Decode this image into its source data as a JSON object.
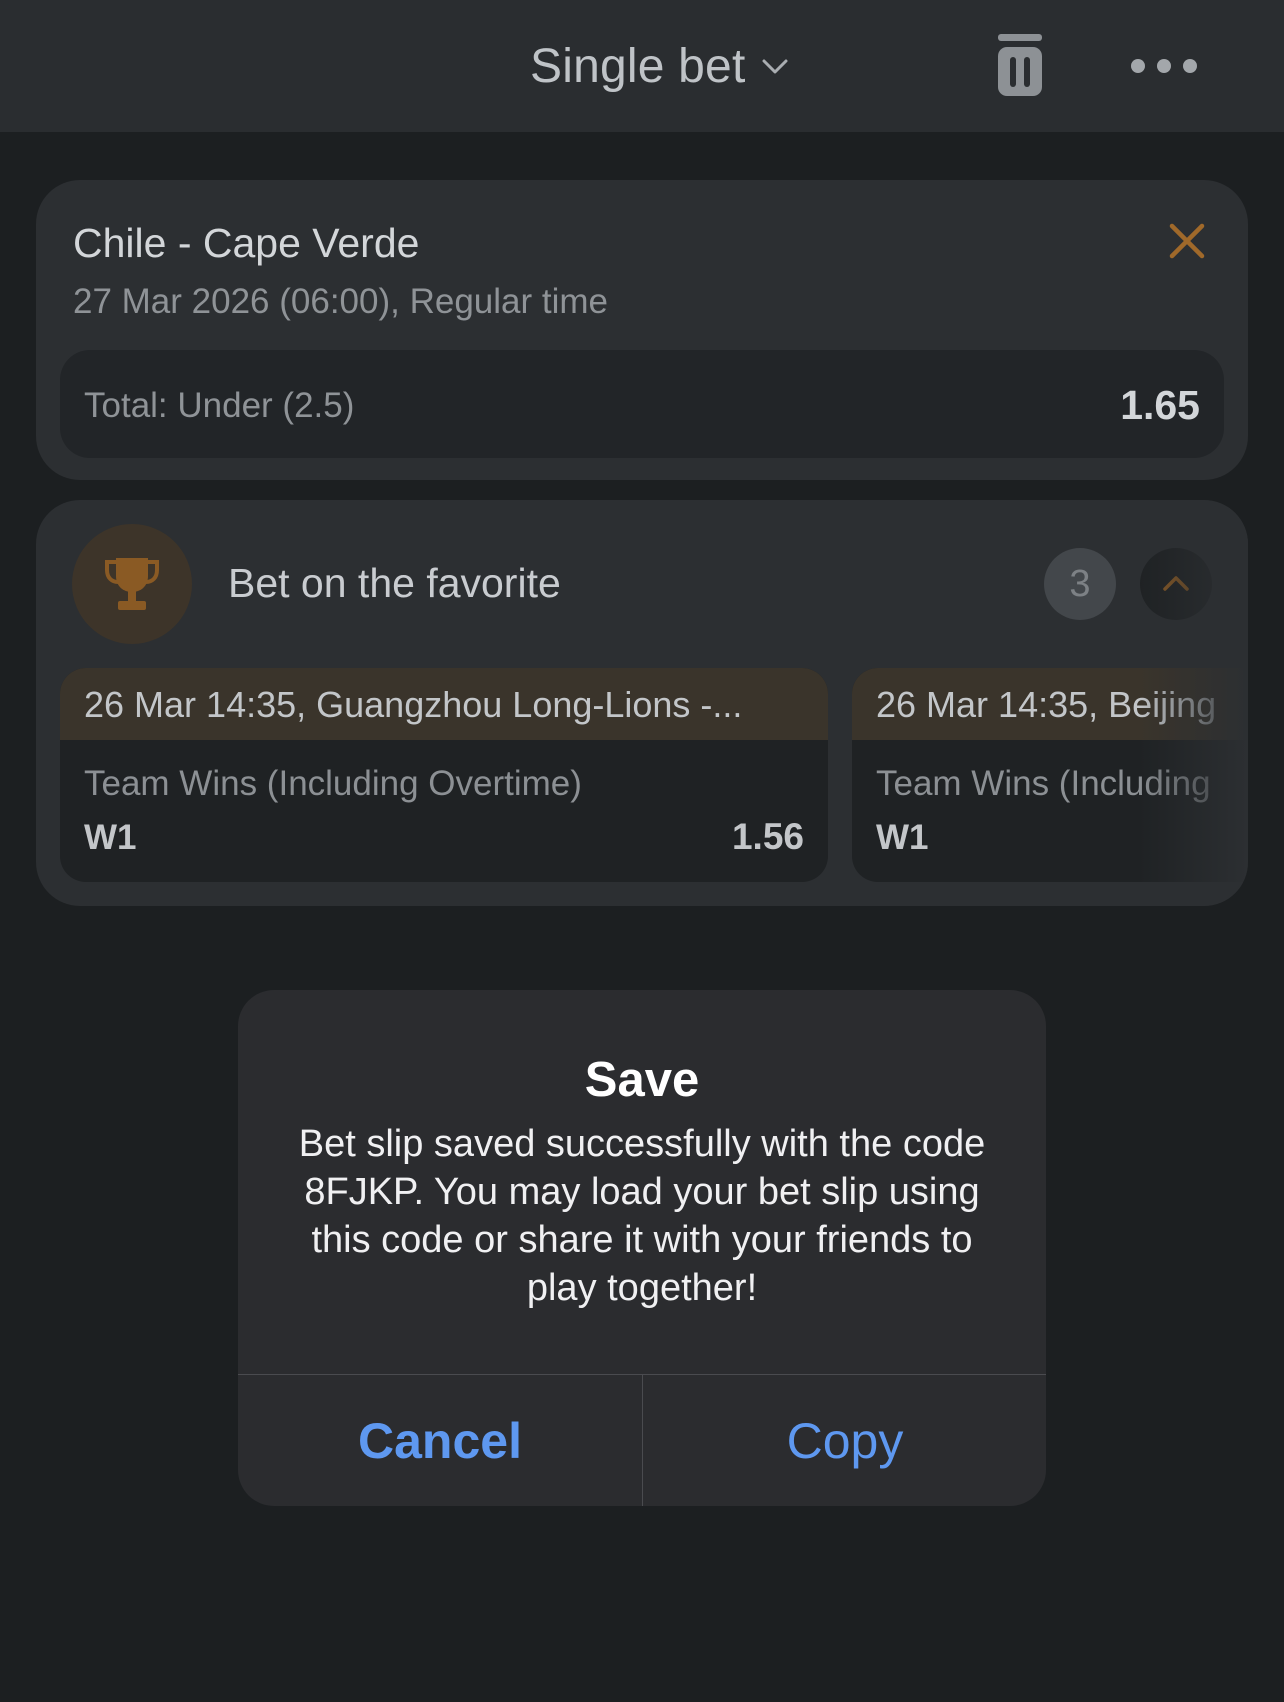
{
  "header": {
    "title": "Single bet",
    "icons": [
      "chevron-down-icon",
      "trash-icon",
      "more-icon"
    ]
  },
  "bet": {
    "match": "Chile - Cape Verde",
    "meta": "27 Mar 2026 (06:00), Regular time",
    "market": "Total: Under (2.5)",
    "odds": "1.65"
  },
  "favorite": {
    "title": "Bet on the favorite",
    "count": "3",
    "items": [
      {
        "header": "26 Mar 14:35, Guangzhou Long-Lions -...",
        "market": "Team Wins (Including Overtime)",
        "pick": "W1",
        "odds": "1.56"
      },
      {
        "header": "26 Mar 14:35, Beijing",
        "market": "Team Wins (Including",
        "pick": "W1"
      }
    ]
  },
  "dialog": {
    "title": "Save",
    "message": "Bet slip saved successfully with the code 8FJKP. You may load your bet slip using this code or share it with your friends to play together!",
    "cancel_label": "Cancel",
    "copy_label": "Copy"
  },
  "colors": {
    "accent_orange": "#a0692a",
    "dialog_button_blue": "#5e98f0"
  }
}
